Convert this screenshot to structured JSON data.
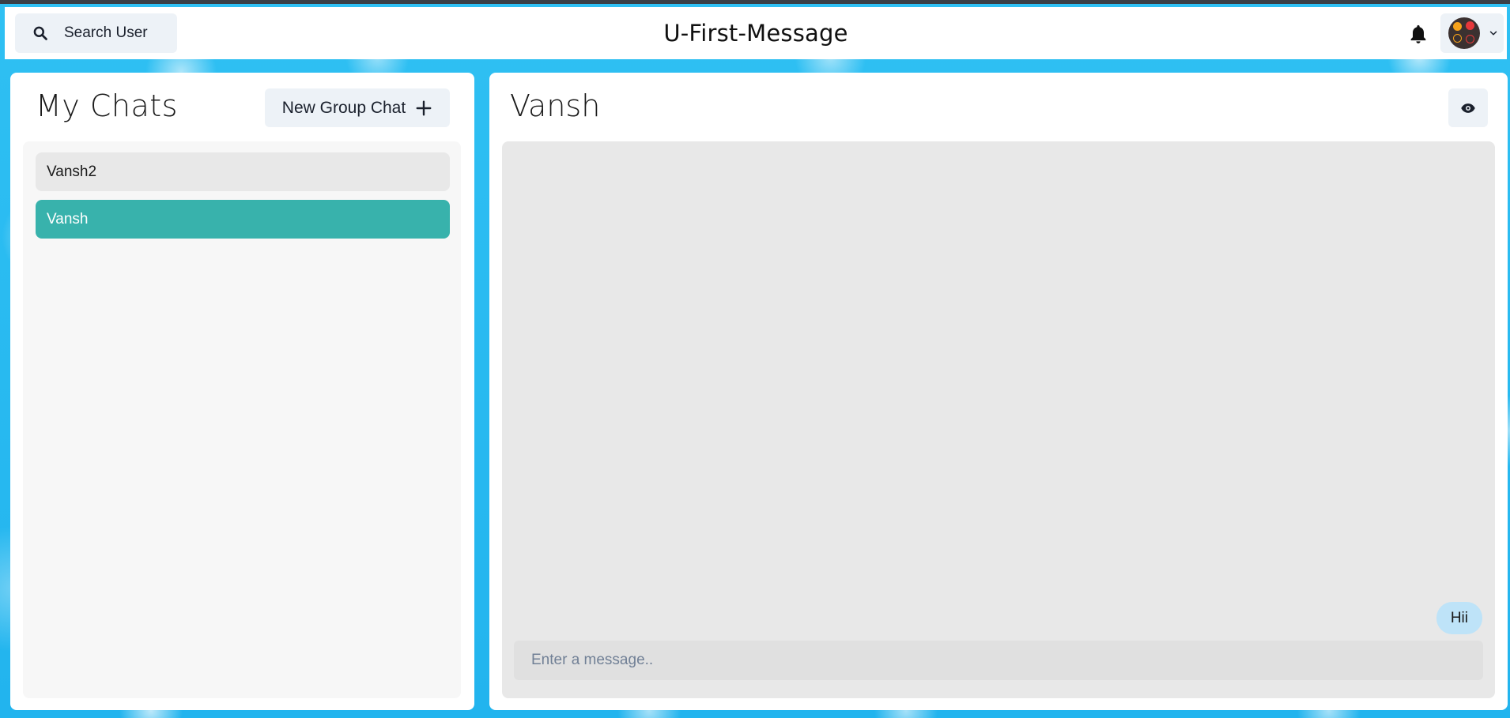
{
  "header": {
    "search_label": "Search User",
    "app_title": "U-First-Message"
  },
  "left_panel": {
    "title": "My Chats",
    "new_group_label": "New Group Chat",
    "chats": [
      {
        "name": "Vansh2",
        "selected": false
      },
      {
        "name": "Vansh",
        "selected": true
      }
    ]
  },
  "right_panel": {
    "chat_name": "Vansh",
    "messages": [
      {
        "text": "Hii",
        "from_self": true
      }
    ],
    "input_placeholder": "Enter a message.."
  },
  "colors": {
    "accent": "#38b2ac",
    "bubble": "#bee3f8",
    "background": "#2bbcf0"
  },
  "icons": [
    "search-icon",
    "bell-icon",
    "chevron-down-icon",
    "plus-icon",
    "eye-icon"
  ]
}
